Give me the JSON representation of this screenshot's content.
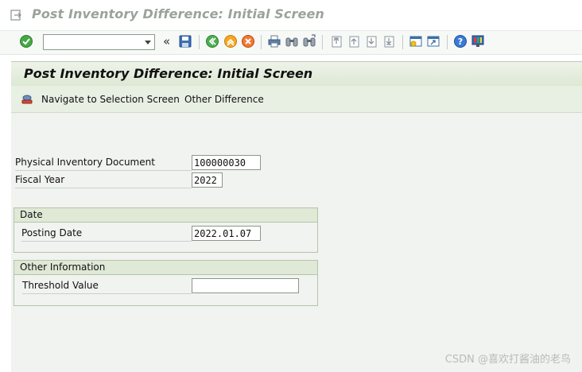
{
  "window": {
    "title": "Post Inventory Difference: Initial Screen"
  },
  "toolbar": {
    "command_field": {
      "value": "",
      "placeholder": ""
    },
    "icons": [
      "enter-icon",
      "save-icon",
      "back-icon",
      "exit-icon",
      "cancel-icon",
      "print-icon",
      "find-icon",
      "find-next-icon",
      "first-page-icon",
      "previous-page-icon",
      "next-page-icon",
      "last-page-icon",
      "create-session-icon",
      "shortcut-icon",
      "help-icon",
      "customize-layout-icon"
    ]
  },
  "screen": {
    "title": "Post Inventory Difference: Initial Screen"
  },
  "app_toolbar": {
    "navigate_label": "Navigate to Selection Screen",
    "other_difference_label": "Other Difference"
  },
  "fields": {
    "phys_inv_doc": {
      "label": "Physical Inventory Document",
      "value": "100000030"
    },
    "fiscal_year": {
      "label": "Fiscal Year",
      "value": "2022"
    }
  },
  "date_group": {
    "title": "Date",
    "posting_date": {
      "label": "Posting Date",
      "value": "2022.01.07"
    }
  },
  "other_info_group": {
    "title": "Other Information",
    "threshold_value": {
      "label": "Threshold Value",
      "value": ""
    }
  },
  "watermark": "CSDN @喜欢打酱油的老鸟",
  "colors": {
    "header_green": "#dde8d4",
    "content_bg": "#f0f3f0",
    "group_border": "#b4c4a8",
    "accent_green": "#2f9e2f",
    "exit_orange": "#f0a020",
    "cancel_red": "#e04020",
    "help_blue": "#2b6fc9"
  }
}
